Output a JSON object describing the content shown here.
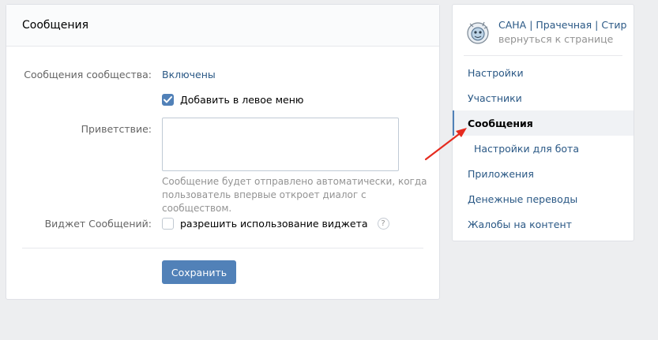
{
  "main": {
    "header": "Сообщения",
    "messages_label": "Сообщения сообщества:",
    "messages_value": "Включены",
    "add_left_menu_label": "Добавить в левое меню",
    "add_left_menu_checked": true,
    "greeting_label": "Приветствие:",
    "greeting_value": "",
    "hint_line1": "Сообщение будет отправлено автоматически, когда",
    "hint_line2": "пользователь впервые откроет диалог с сообществом.",
    "widget_label": "Виджет Сообщений:",
    "widget_checkbox_label": "разрешить использование виджета",
    "widget_checked": false,
    "help_icon": "?",
    "save_label": "Сохранить"
  },
  "sidebar": {
    "community_title": "САНА | Прачечная | Стир",
    "back_link": "вернуться к странице",
    "items": [
      {
        "label": "Настройки",
        "active": false,
        "sub": false
      },
      {
        "label": "Участники",
        "active": false,
        "sub": false
      },
      {
        "label": "Сообщения",
        "active": true,
        "sub": false
      },
      {
        "label": "Настройки для бота",
        "active": false,
        "sub": true
      },
      {
        "label": "Приложения",
        "active": false,
        "sub": false
      },
      {
        "label": "Денежные переводы",
        "active": false,
        "sub": false
      },
      {
        "label": "Жалобы на контент",
        "active": false,
        "sub": false
      }
    ]
  },
  "colors": {
    "accent": "#5181b8",
    "link": "#2a5885",
    "annotation_arrow": "#e52b1f",
    "background": "#edeef0"
  }
}
